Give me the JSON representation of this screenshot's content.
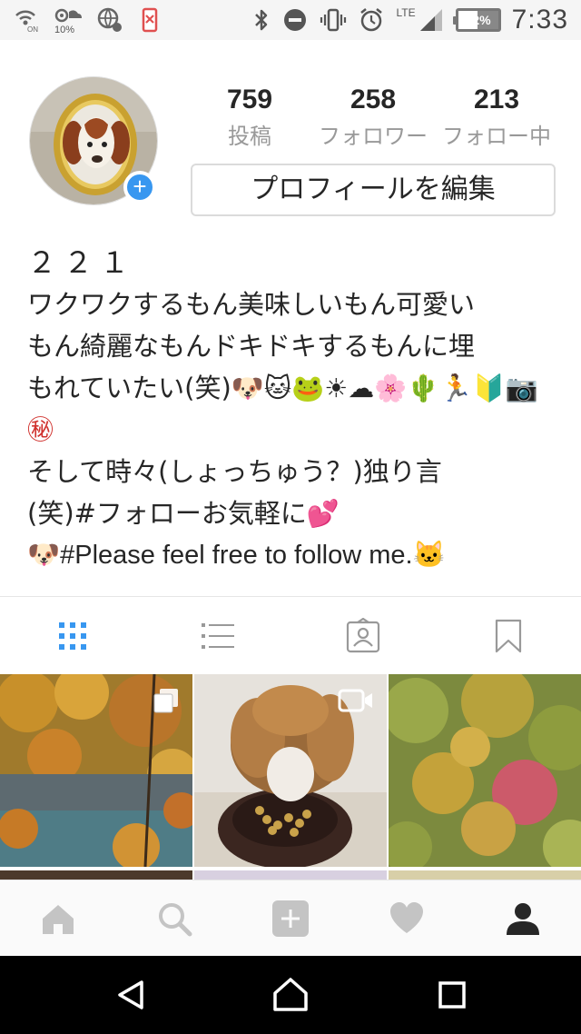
{
  "status_bar": {
    "wifi_calling_label": "ON",
    "data_saver_percent": "10%",
    "network_type": "LTE",
    "battery_percent": "52%",
    "battery_level": 0.52,
    "time": "7:33"
  },
  "profile": {
    "stats": [
      {
        "count": "759",
        "label": "投稿"
      },
      {
        "count": "258",
        "label": "フォロワー"
      },
      {
        "count": "213",
        "label": "フォロー中"
      }
    ],
    "edit_button_label": "プロフィールを編集",
    "name": "２２１",
    "bio_lines": [
      "ワクワクするもん美味しいもん可愛い",
      "もん綺麗なもんドキドキするもんに埋",
      "もれていたい(笑)🐶🐱🐸☀☁🌸🌵🏃🔰📷",
      "㊙",
      "そして時々(しょっちゅう？)独り言",
      "(笑)#フォローお気軽に💕",
      "🐶#Please feel free to follow me.🐱"
    ]
  },
  "view_tabs": [
    {
      "name": "grid-view",
      "icon": "grid-icon",
      "active": true
    },
    {
      "name": "list-view",
      "icon": "list-icon",
      "active": false
    },
    {
      "name": "tagged-view",
      "icon": "tagged-person-icon",
      "active": false
    },
    {
      "name": "saved-view",
      "icon": "bookmark-icon",
      "active": false
    }
  ],
  "posts": [
    {
      "type": "carousel",
      "subject": "autumn leaves over river",
      "badge_icon": "multiple-photos-icon"
    },
    {
      "type": "video",
      "subject": "dog eating from bowl",
      "badge_icon": "video-icon"
    },
    {
      "type": "photo",
      "subject": "colorful maple leaves"
    }
  ],
  "bottom_nav": [
    "home-icon",
    "search-icon",
    "add-post-icon",
    "activity-heart-icon",
    "profile-icon"
  ],
  "colors": {
    "accent_blue": "#3897f0",
    "text_primary": "#262626",
    "text_secondary": "#999999",
    "border": "#dbdbdb"
  }
}
